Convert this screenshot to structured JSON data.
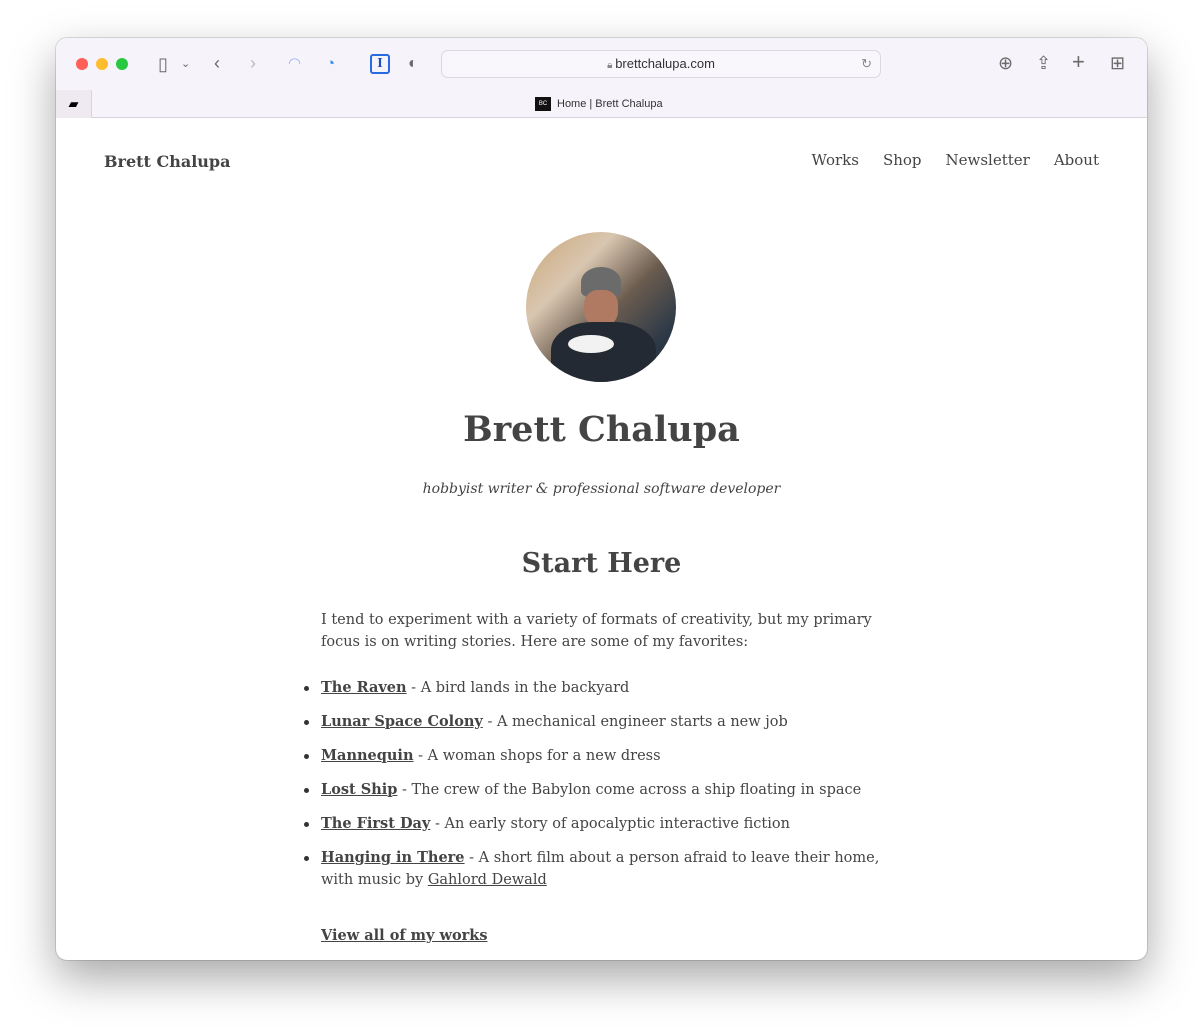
{
  "browser": {
    "url": "brettchalupa.com",
    "tab_title": "Home | Brett Chalupa",
    "favicon_text": "BC"
  },
  "site": {
    "brand": "Brett Chalupa",
    "nav": [
      "Works",
      "Shop",
      "Newsletter",
      "About"
    ]
  },
  "hero": {
    "name": "Brett Chalupa",
    "tagline": "hobbyist writer & professional software developer"
  },
  "start": {
    "heading": "Start Here",
    "intro": "I tend to experiment with a variety of formats of creativity, but my primary focus is on writing stories. Here are some of my favorites:",
    "items": [
      {
        "title": "The Raven",
        "desc": " - A bird lands in the backyard"
      },
      {
        "title": "Lunar Space Colony",
        "desc": " - A mechanical engineer starts a new job"
      },
      {
        "title": "Mannequin",
        "desc": " - A woman shops for a new dress"
      },
      {
        "title": "Lost Ship",
        "desc": " - The crew of the Babylon come across a ship floating in space"
      },
      {
        "title": "The First Day",
        "desc": " - An early story of apocalyptic interactive fiction"
      },
      {
        "title": "Hanging in There",
        "desc": " - A short film about a person afraid to leave their home, with music by ",
        "extra_link": "Gahlord Dewald"
      }
    ],
    "view_all": "View all of my works"
  }
}
